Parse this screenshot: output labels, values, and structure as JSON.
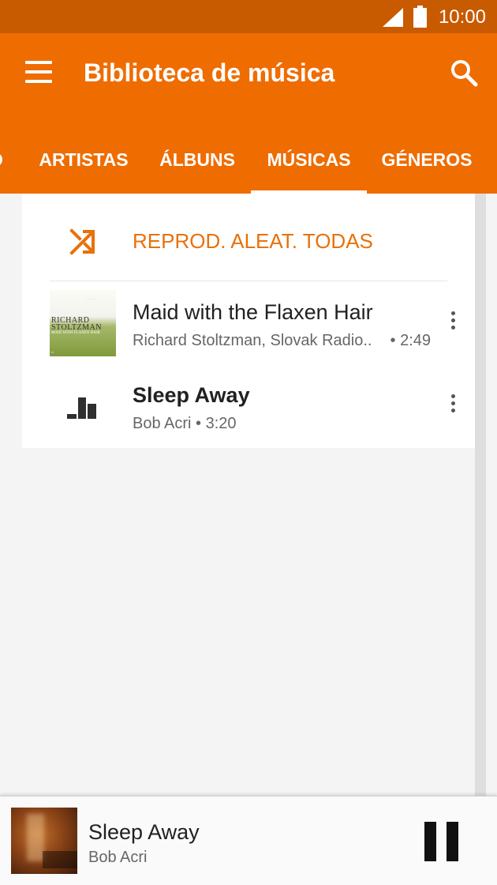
{
  "status_bar": {
    "time": "10:00",
    "icons": [
      "signal-icon",
      "battery-icon"
    ],
    "color": "#c85a00"
  },
  "app_bar": {
    "title": "Biblioteca de música",
    "color": "#ef6c00",
    "icons": [
      "menu-icon",
      "search-icon"
    ]
  },
  "tabs": [
    {
      "label": "O",
      "active": false
    },
    {
      "label": "ARTISTAS",
      "active": false
    },
    {
      "label": "ÁLBUNS",
      "active": false
    },
    {
      "label": "MÚSICAS",
      "active": true
    },
    {
      "label": "GÉNEROS",
      "active": false
    }
  ],
  "shuffle": {
    "label": "REPROD. ALEAT. TODAS",
    "icon": "shuffle-icon",
    "color": "#e8710a"
  },
  "songs": [
    {
      "title": "Maid with the Flaxen Hair",
      "subtitle": "Richard Stoltzman, Slovak Radio..",
      "duration": "• 2:49",
      "art": {
        "line1": "RICHARD",
        "line2": "STOLTZMAN",
        "line3": "MAID WITH FLAXEN HAIR"
      }
    },
    {
      "title": "Sleep Away",
      "subtitle": "Bob Acri • 3:20",
      "duration": "",
      "playing": true,
      "icon": "equalizer-icon"
    }
  ],
  "now_playing": {
    "title": "Sleep Away",
    "artist": "Bob Acri",
    "icon": "pause-icon"
  }
}
